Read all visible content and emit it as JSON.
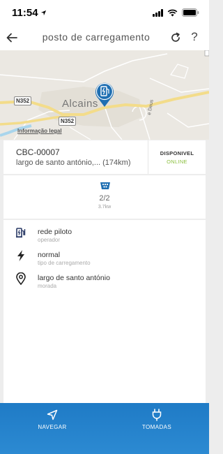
{
  "status_bar": {
    "time": "11:54"
  },
  "header": {
    "title": "posto de carregamento"
  },
  "map": {
    "town": "Alcains",
    "road_badge_1": "N352",
    "road_badge_2": "N352",
    "legal_link": "Informação legal",
    "street_fragment": "e Deus"
  },
  "station": {
    "code": "CBC-00007",
    "address": "largo de santo antónio,... (174km)",
    "status_label": "DISPONIVEL",
    "status_online": "ONLINE"
  },
  "plugs": {
    "count": "2/2",
    "power": "3.7kw"
  },
  "details": [
    {
      "value": "rede piloto",
      "label": "operador",
      "icon": "ev-charger-icon"
    },
    {
      "value": "normal",
      "label": "tipo de carregamento",
      "icon": "lightning-bolt-icon"
    },
    {
      "value": "largo de santo antónio",
      "label": "morada",
      "icon": "map-pin-icon"
    }
  ],
  "bottom_nav": {
    "navigate_label": "NAVEGAR",
    "sockets_label": "TOMADAS"
  },
  "colors": {
    "accent_blue": "#1f7bc6",
    "online_green": "#8bbf3f",
    "pin_blue": "#1f6fb2"
  }
}
